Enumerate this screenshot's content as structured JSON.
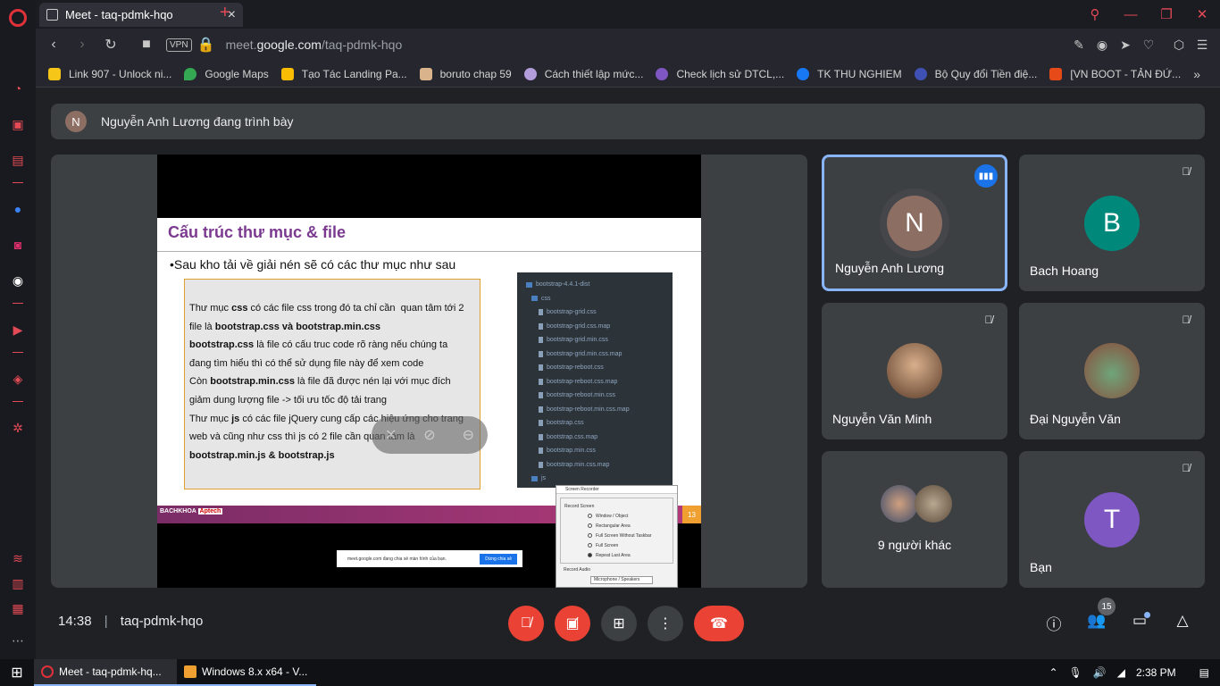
{
  "browser": {
    "tab_title": "Meet - taq-pdmk-hqo",
    "url_prefix": "meet.",
    "url_domain": "google.com",
    "url_path": "/taq-pdmk-hqo",
    "vpn_label": "VPN",
    "bookmarks": [
      {
        "label": "Link 907 - Unlock ni...",
        "color": "#f5c518"
      },
      {
        "label": "Google Maps",
        "color": "#34a853"
      },
      {
        "label": "Tạo Tác Landing Pa...",
        "color": "#fbbc04"
      },
      {
        "label": "boruto chap 59",
        "color": "#d9b38c"
      },
      {
        "label": "Cách thiết lập mức...",
        "color": "#b39ddb"
      },
      {
        "label": "Check lịch sử DTCL,...",
        "color": "#7e57c2"
      },
      {
        "label": "TK THU NGHIEM",
        "color": "#1877f2"
      },
      {
        "label": "Bộ Quy đổi Tiền điệ...",
        "color": "#3f51b5"
      },
      {
        "label": "[VN BOOT - TẢN ĐỨ...",
        "color": "#e64a19"
      }
    ]
  },
  "meet": {
    "presenting_banner": "Nguyễn Anh Lương đang trình bày",
    "presenter_initial": "N",
    "meeting_time": "14:38",
    "meeting_code": "taq-pdmk-hqo",
    "participants_count": "15",
    "participants": [
      {
        "name": "Nguyễn Anh Lương",
        "initial": "N",
        "color": "#8d6e63"
      },
      {
        "name": "Bach Hoang",
        "initial": "B",
        "color": "#00897b"
      },
      {
        "name": "Nguyễn Văn Minh",
        "initial": "",
        "color": "#a0522d"
      },
      {
        "name": "Đại Nguyễn Văn",
        "initial": "",
        "color": "#5a8f6b"
      },
      {
        "name": "9 người khác",
        "initial": "",
        "color": "#6d5d4b"
      },
      {
        "name": "Bạn",
        "initial": "T",
        "color": "#7e57c2"
      }
    ]
  },
  "slide": {
    "title": "Cấu trúc thư mục & file",
    "subtitle": "•Sau kho tải về giải nén sẽ có các thư mục như sau",
    "page_number": "13",
    "footer_brand": "BACHKHOA",
    "footer_brand2": "Aptech",
    "tree": [
      "bootstrap-4.4.1-dist",
      "css",
      "bootstrap-grid.css",
      "bootstrap-grid.css.map",
      "bootstrap-grid.min.css",
      "bootstrap-grid.min.css.map",
      "bootstrap-reboot.css",
      "bootstrap-reboot.css.map",
      "bootstrap-reboot.min.css",
      "bootstrap-reboot.min.css.map",
      "bootstrap.css",
      "bootstrap.css.map",
      "bootstrap.min.css",
      "bootstrap.min.css.map",
      "js"
    ],
    "share_note": "meet.google.com đang chia sẻ màn hình của bạn.",
    "share_stop": "Dừng chia sẻ"
  },
  "recorder": {
    "title": "Screen Recorder",
    "group": "Record Screen",
    "options": [
      "Window / Object",
      "Rectangular Area",
      "Full Screen Without Taskbar",
      "Full Screen",
      "Repeat Last Area"
    ],
    "audio": "Record Audio",
    "device": "Microphone / Speakers"
  },
  "taskbar": {
    "items": [
      "Meet - taq-pdmk-hq...",
      "Windows 8.x x64 - V..."
    ],
    "time": "2:38 PM"
  }
}
